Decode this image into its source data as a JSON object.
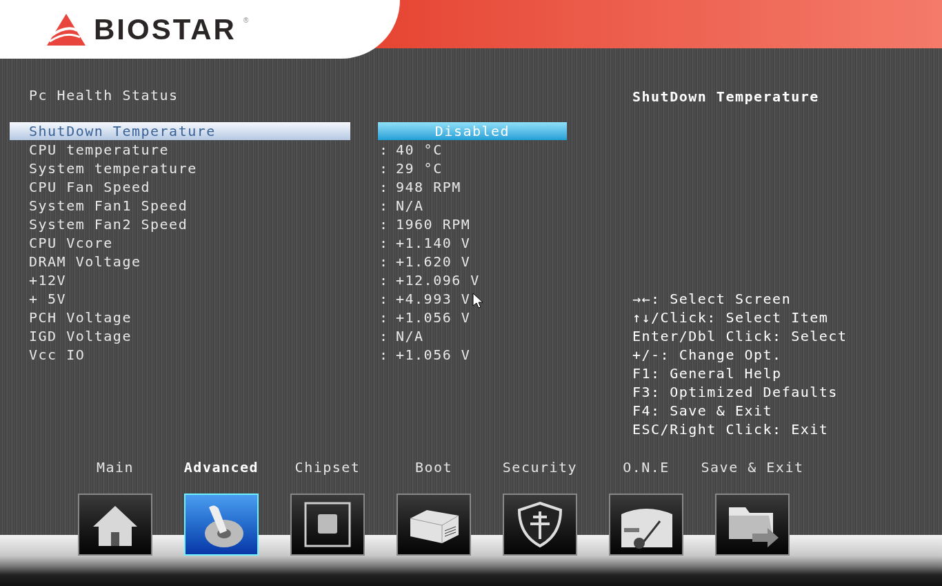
{
  "logo": {
    "text": "BIOSTAR",
    "mark": "®"
  },
  "page_title": "Pc Health Status",
  "items": [
    {
      "label": "ShutDown Temperature",
      "value": "Disabled",
      "kind": "option",
      "selected": true
    },
    {
      "label": "CPU temperature",
      "value": "40 °C",
      "kind": "info",
      "selected": false
    },
    {
      "label": "System temperature",
      "value": "29 °C",
      "kind": "info",
      "selected": false
    },
    {
      "label": "CPU Fan Speed",
      "value": "948 RPM",
      "kind": "info",
      "selected": false
    },
    {
      "label": "System Fan1 Speed",
      "value": "N/A",
      "kind": "info",
      "selected": false
    },
    {
      "label": "System Fan2 Speed",
      "value": "1960 RPM",
      "kind": "info",
      "selected": false
    },
    {
      "label": "CPU Vcore",
      "value": "+1.140 V",
      "kind": "info",
      "selected": false
    },
    {
      "label": "DRAM Voltage",
      "value": "+1.620 V",
      "kind": "info",
      "selected": false
    },
    {
      "label": "+12V",
      "value": "+12.096 V",
      "kind": "info",
      "selected": false
    },
    {
      "label": "+ 5V",
      "value": "+4.993 V",
      "kind": "info",
      "selected": false
    },
    {
      "label": "PCH Voltage",
      "value": "+1.056 V",
      "kind": "info",
      "selected": false
    },
    {
      "label": "IGD Voltage",
      "value": "N/A",
      "kind": "info",
      "selected": false
    },
    {
      "label": "Vcc IO",
      "value": "+1.056 V",
      "kind": "info",
      "selected": false
    }
  ],
  "separator": ":",
  "help_title": "ShutDown Temperature",
  "help_lines": [
    "→←: Select Screen",
    "↑↓/Click: Select Item",
    "Enter/Dbl Click: Select",
    "+/-: Change Opt.",
    "F1: General Help",
    "F3: Optimized Defaults",
    "F4: Save & Exit",
    "ESC/Right Click: Exit"
  ],
  "tabs": [
    {
      "label": "Main",
      "selected": false
    },
    {
      "label": "Advanced",
      "selected": true
    },
    {
      "label": "Chipset",
      "selected": false
    },
    {
      "label": "Boot",
      "selected": false
    },
    {
      "label": "Security",
      "selected": false
    },
    {
      "label": "O.N.E",
      "selected": false
    },
    {
      "label": "Save & Exit",
      "selected": false
    }
  ]
}
